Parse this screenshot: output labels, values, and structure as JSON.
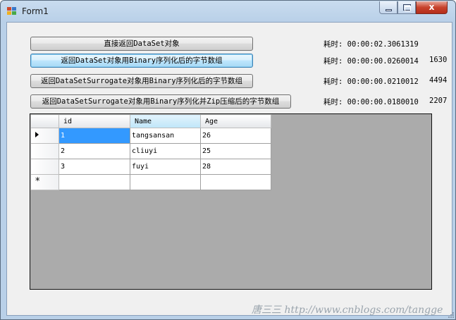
{
  "window": {
    "title": "Form1",
    "caption_buttons": {
      "minimize_icon": "minimize-icon",
      "maximize_icon": "maximize-icon",
      "close_glyph": "x"
    }
  },
  "buttons": [
    {
      "label": "直接返回DataSet对象"
    },
    {
      "label": "返回DataSet对象用Binary序列化后的字节数组"
    },
    {
      "label": "返回DataSetSurrogate对象用Binary序列化后的字节数组"
    },
    {
      "label": "返回DataSetSurrogate对象用Binary序列化并Zip压缩后的字节数组"
    }
  ],
  "timings": [
    {
      "text": "耗时: 00:00:02.3061319",
      "size": ""
    },
    {
      "text": "耗时: 00:00:00.0260014",
      "size": "1630"
    },
    {
      "text": "耗时: 00:00:00.0210012",
      "size": "4494"
    },
    {
      "text": "耗时: 00:00:00.0180010",
      "size": "2207"
    }
  ],
  "grid": {
    "columns": [
      "id",
      "Name",
      "Age"
    ],
    "rows": [
      [
        "1",
        "tangsansan",
        "26"
      ],
      [
        "2",
        "cliuyi",
        "25"
      ],
      [
        "3",
        "fuyi",
        "28"
      ]
    ],
    "new_row_marker": "*",
    "current_row_marker": "row-pointer-icon"
  },
  "watermark": "唐三三 http://www.cnblogs.com/tangge"
}
